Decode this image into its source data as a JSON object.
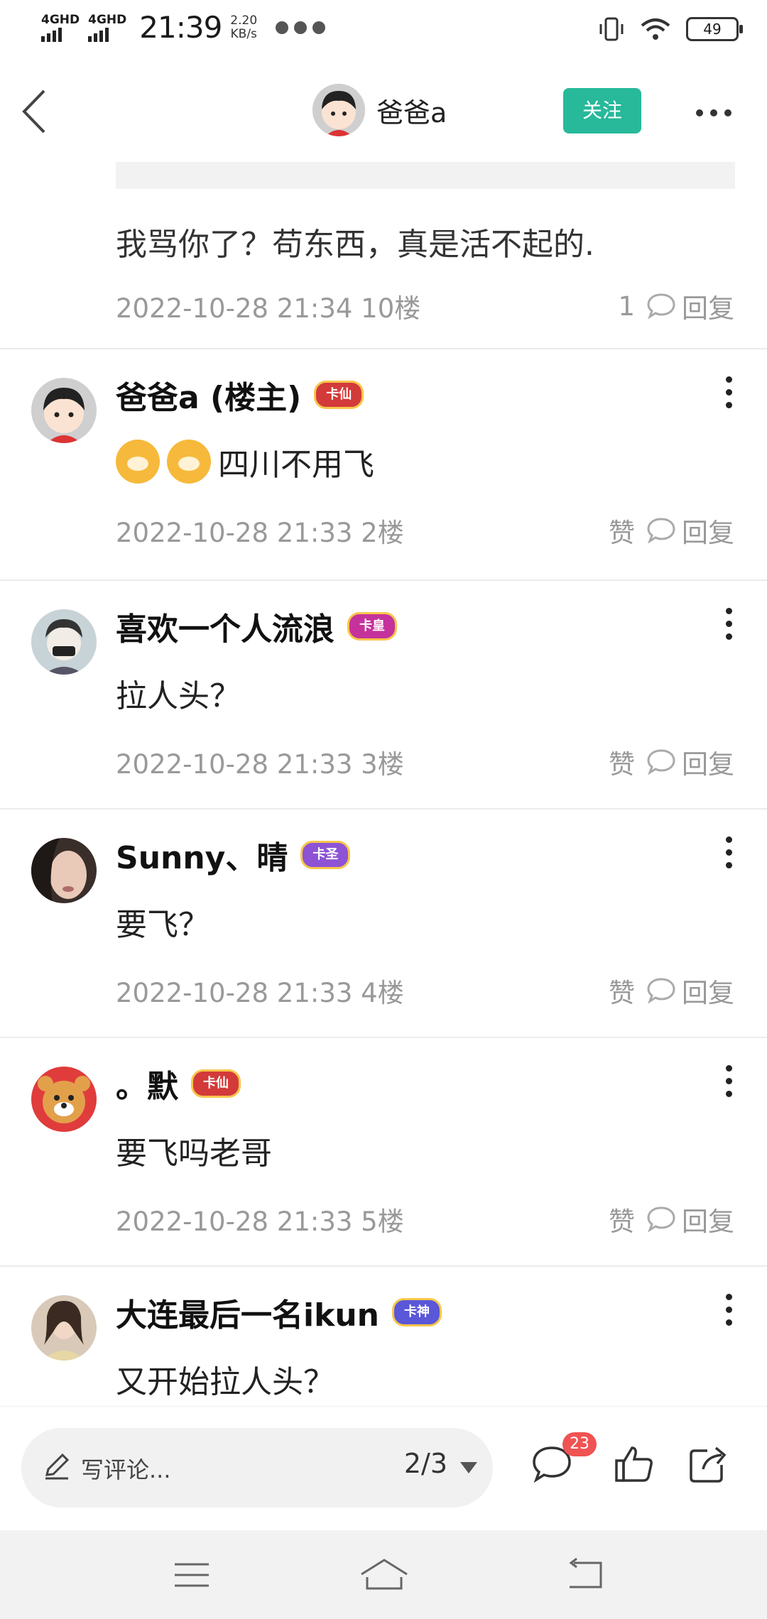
{
  "status_bar": {
    "network1": "4GHD",
    "network2": "4GHD",
    "time": "21:39",
    "speed_value": "2.20",
    "speed_unit": "KB/s",
    "battery": "49"
  },
  "header": {
    "title": "爸爸a",
    "follow_label": "关注"
  },
  "floor10": {
    "text": "我骂你了？苟东西，真是活不起的.",
    "meta": "2022-10-28 21:34  10楼",
    "like_count": "1",
    "reply_label": "回复"
  },
  "posts": [
    {
      "username": "爸爸a (楼主)",
      "badge": "卡仙",
      "text": "四川不用飞",
      "meta": "2022-10-28 21:33  2楼",
      "like_label": "赞",
      "reply_label": "回复"
    },
    {
      "username": "喜欢一个人流浪",
      "badge": "卡皇",
      "text": "拉人头？",
      "meta": "2022-10-28 21:33  3楼",
      "like_label": "赞",
      "reply_label": "回复"
    },
    {
      "username": "Sunny、晴",
      "badge": "卡圣",
      "text": "要飞？",
      "meta": "2022-10-28 21:33  4楼",
      "like_label": "赞",
      "reply_label": "回复"
    },
    {
      "username": "。默",
      "badge": "卡仙",
      "text": "要飞吗老哥",
      "meta": "2022-10-28 21:33  5楼",
      "like_label": "赞",
      "reply_label": "回复"
    },
    {
      "username": "大连最后一名ikun",
      "badge": "卡神",
      "text": "又开始拉人头？"
    }
  ],
  "bottom_bar": {
    "comment_placeholder": "写评论...",
    "page_indicator": "2/3",
    "comment_count": "23"
  },
  "colors": {
    "accent": "#27b99a",
    "badge_red": "#f05353"
  }
}
